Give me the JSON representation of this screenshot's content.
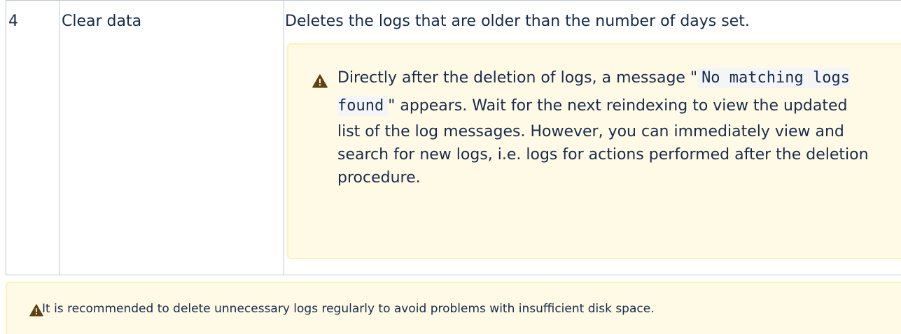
{
  "table": {
    "row": {
      "number": "4",
      "name": "Clear data",
      "description": "Deletes the logs that are older than the number of days set."
    },
    "inner_note": {
      "icon": "warning-icon",
      "text_before": "Directly after the deletion of logs, a message \"",
      "code": "No matching logs found",
      "text_after": "\" appears. Wait for the next reindexing to view the updated list of the log messages. However, you can immediately view and search for new logs, i.e. logs for actions performed after the deletion procedure."
    }
  },
  "bottom_note": {
    "icon": "warning-icon",
    "text": "It is recommended to delete unnecessary logs regularly to avoid problems with insufficient disk space."
  },
  "colors": {
    "warning_bg": "#fffae6",
    "warning_border": "#fff0b3",
    "warning_icon": "#5e4215",
    "table_border": "#c1c7d0",
    "text": "#172b4d"
  }
}
